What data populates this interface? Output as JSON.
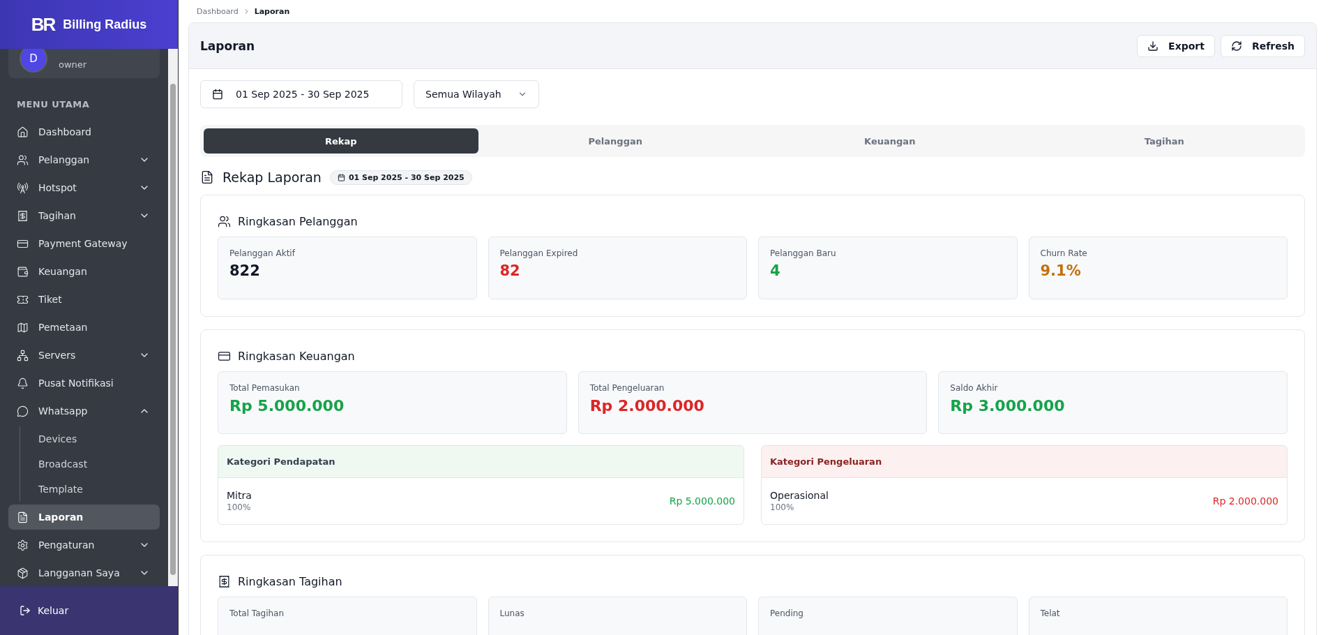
{
  "brand": {
    "logo": "BR",
    "name": "Billing Radius"
  },
  "user": {
    "avatar": "D",
    "role": "owner"
  },
  "sidebar": {
    "section": "MENU UTAMA",
    "items": [
      {
        "label": "Dashboard",
        "kind": "link",
        "selected": false
      },
      {
        "label": "Pelanggan",
        "kind": "group",
        "selected": false,
        "expanded": false
      },
      {
        "label": "Hotspot",
        "kind": "group",
        "selected": false,
        "expanded": false
      },
      {
        "label": "Tagihan",
        "kind": "group",
        "selected": false,
        "expanded": false
      },
      {
        "label": "Payment Gateway",
        "kind": "link",
        "selected": false
      },
      {
        "label": "Keuangan",
        "kind": "link",
        "selected": false
      },
      {
        "label": "Tiket",
        "kind": "link",
        "selected": false
      },
      {
        "label": "Pemetaan",
        "kind": "link",
        "selected": false
      },
      {
        "label": "Servers",
        "kind": "group",
        "selected": false,
        "expanded": false
      },
      {
        "label": "Pusat Notifikasi",
        "kind": "link",
        "selected": false
      },
      {
        "label": "Whatsapp",
        "kind": "group",
        "selected": false,
        "expanded": true,
        "children": [
          {
            "label": "Devices",
            "selected": false
          },
          {
            "label": "Broadcast",
            "selected": false
          },
          {
            "label": "Template",
            "selected": false
          }
        ]
      },
      {
        "label": "Laporan",
        "kind": "link",
        "selected": true
      },
      {
        "label": "Pengaturan",
        "kind": "group",
        "selected": false,
        "expanded": false
      },
      {
        "label": "Langganan Saya",
        "kind": "group",
        "selected": false,
        "expanded": false
      }
    ],
    "logout": "Keluar"
  },
  "breadcrumb": [
    "Dashboard",
    "Laporan"
  ],
  "page": {
    "title": "Laporan",
    "buttons": [
      "Export",
      "Refresh"
    ]
  },
  "filters": {
    "date_range": "01 Sep 2025 - 30 Sep 2025",
    "region": "Semua Wilayah"
  },
  "tabs": [
    {
      "label": "Rekap",
      "selected": true
    },
    {
      "label": "Pelanggan",
      "selected": false
    },
    {
      "label": "Keuangan",
      "selected": false
    },
    {
      "label": "Tagihan",
      "selected": false
    }
  ],
  "recap": {
    "title": "Rekap Laporan",
    "period": "01 Sep 2025 - 30 Sep 2025"
  },
  "sections": [
    {
      "title": "Ringkasan Pelanggan",
      "stats": [
        {
          "label": "Pelanggan Aktif",
          "value": "822",
          "color": "#111827"
        },
        {
          "label": "Pelanggan Expired",
          "value": "82",
          "color": "#dc2626"
        },
        {
          "label": "Pelanggan Baru",
          "value": "4",
          "color": "#16a34a"
        },
        {
          "label": "Churn Rate",
          "value": "9.1%",
          "color": "#c2700c"
        }
      ]
    },
    {
      "title": "Ringkasan Keuangan",
      "stats": [
        {
          "label": "Total Pemasukan",
          "value": "Rp 5.000.000",
          "color": "#16a34a"
        },
        {
          "label": "Total Pengeluaran",
          "value": "Rp 2.000.000",
          "color": "#dc2626"
        },
        {
          "label": "Saldo Akhir",
          "value": "Rp 3.000.000",
          "color": "#16a34a"
        }
      ],
      "categories": [
        {
          "title": "Kategori Pendapatan",
          "color": "#16a34a",
          "rows": [
            {
              "name": "Mitra",
              "share": "100%",
              "amount": "Rp 5.000.000"
            }
          ]
        },
        {
          "title": "Kategori Pengeluaran",
          "color": "#dc2626",
          "rows": [
            {
              "name": "Operasional",
              "share": "100%",
              "amount": "Rp 2.000.000"
            }
          ]
        }
      ]
    },
    {
      "title": "Ringkasan Tagihan",
      "stats": [
        {
          "label": "Total Tagihan"
        },
        {
          "label": "Lunas"
        },
        {
          "label": "Pending"
        },
        {
          "label": "Telat"
        }
      ]
    }
  ]
}
